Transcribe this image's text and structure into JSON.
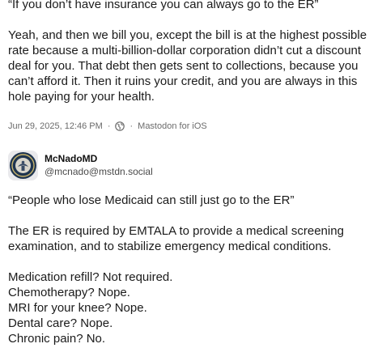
{
  "first_post": {
    "quote_line": "“If you don’t have insurance you can always go to the ER”",
    "paragraph": "Yeah, and then we bill you, except the bill is at the highest possible rate because a multi-billion-dollar corporation didn’t cut a discount deal for you. That debt then gets sent to collections, because you can’t afford it. Then it ruins your credit, and you are always in this hole paying for your health.",
    "meta": {
      "timestamp": "Jun 29, 2025, 12:46 PM",
      "separator": "·",
      "visibility_icon": "globe-icon",
      "client": "Mastodon for iOS"
    }
  },
  "second_post": {
    "author": {
      "avatar_icon": "seal-avatar",
      "display_name": "McNadoMD",
      "handle": "@mcnado@mstdn.social"
    },
    "quote_line": "“People who lose Medicaid can still just go to the ER”",
    "paragraph": "The ER is required by EMTALA to provide a medical screening examination, and to stabilize emergency medical conditions.",
    "list": [
      "Medication refill? Not required.",
      "Chemotherapy? Nope.",
      "MRI for your knee? Nope.",
      "Dental care? Nope.",
      "Chronic pain? No."
    ]
  },
  "colors": {
    "text": "#1b1b1b",
    "meta": "#6b6b6b",
    "avatar_seal": "#1f3550"
  }
}
